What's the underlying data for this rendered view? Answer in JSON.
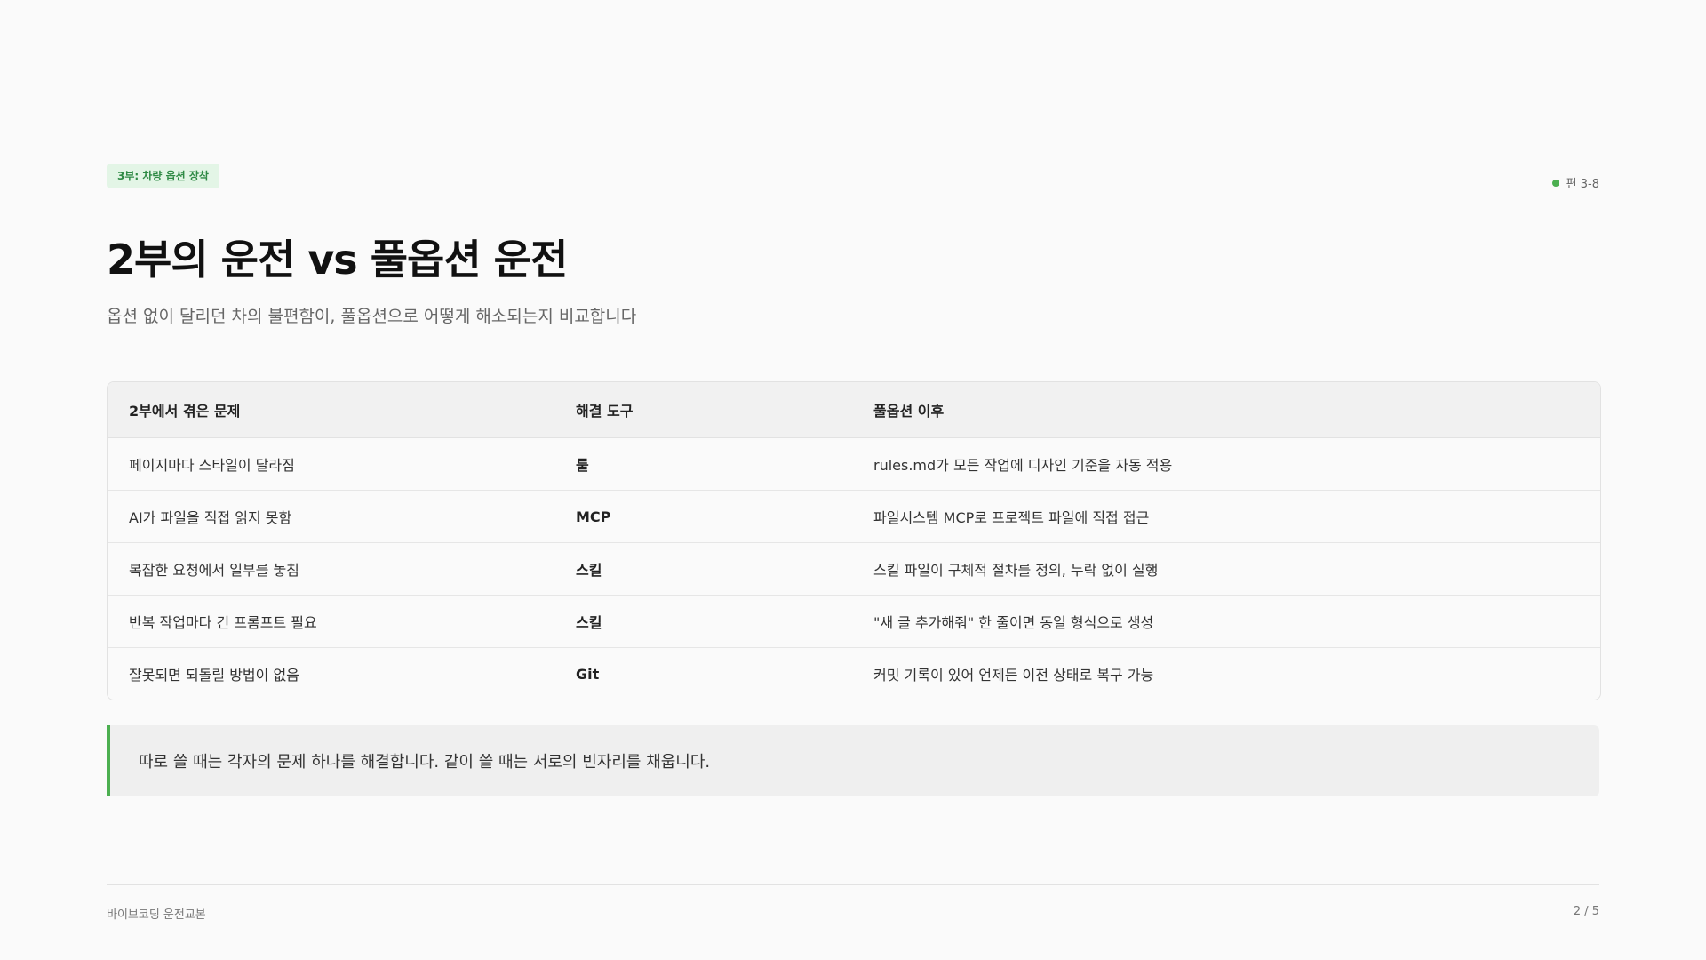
{
  "header": {
    "part_badge": "3부: 차량 옵션 장착",
    "page_tag": "편 3-8"
  },
  "title": "2부의 운전 vs 풀옵션 운전",
  "subtitle": "옵션 없이 달리던 차의 불편함이, 풀옵션으로 어떻게 해소되는지 비교합니다",
  "table": {
    "headers": [
      "2부에서 겪은 문제",
      "해결 도구",
      "풀옵션 이후"
    ],
    "rows": [
      [
        "페이지마다 스타일이 달라짐",
        "룰",
        "rules.md가 모든 작업에 디자인 기준을 자동 적용"
      ],
      [
        "AI가 파일을 직접 읽지 못함",
        "MCP",
        "파일시스템 MCP로 프로젝트 파일에 직접 접근"
      ],
      [
        "복잡한 요청에서 일부를 놓침",
        "스킬",
        "스킬 파일이 구체적 절차를 정의, 누락 없이 실행"
      ],
      [
        "반복 작업마다 긴 프롬프트 필요",
        "스킬",
        "\"새 글 추가해줘\" 한 줄이면 동일 형식으로 생성"
      ],
      [
        "잘못되면 되돌릴 방법이 없음",
        "Git",
        "커밋 기록이 있어 언제든 이전 상태로 복구 가능"
      ]
    ]
  },
  "callout": "따로 쓸 때는 각자의 문제 하나를 해결합니다. 같이 쓸 때는 서로의 빈자리를 채웁니다.",
  "footer": {
    "left": "바이브코딩 운전교본",
    "right": "2 / 5"
  },
  "colors": {
    "accent": "#4caf50",
    "badge_bg": "#e3f5e6",
    "badge_text": "#2f8a45"
  }
}
